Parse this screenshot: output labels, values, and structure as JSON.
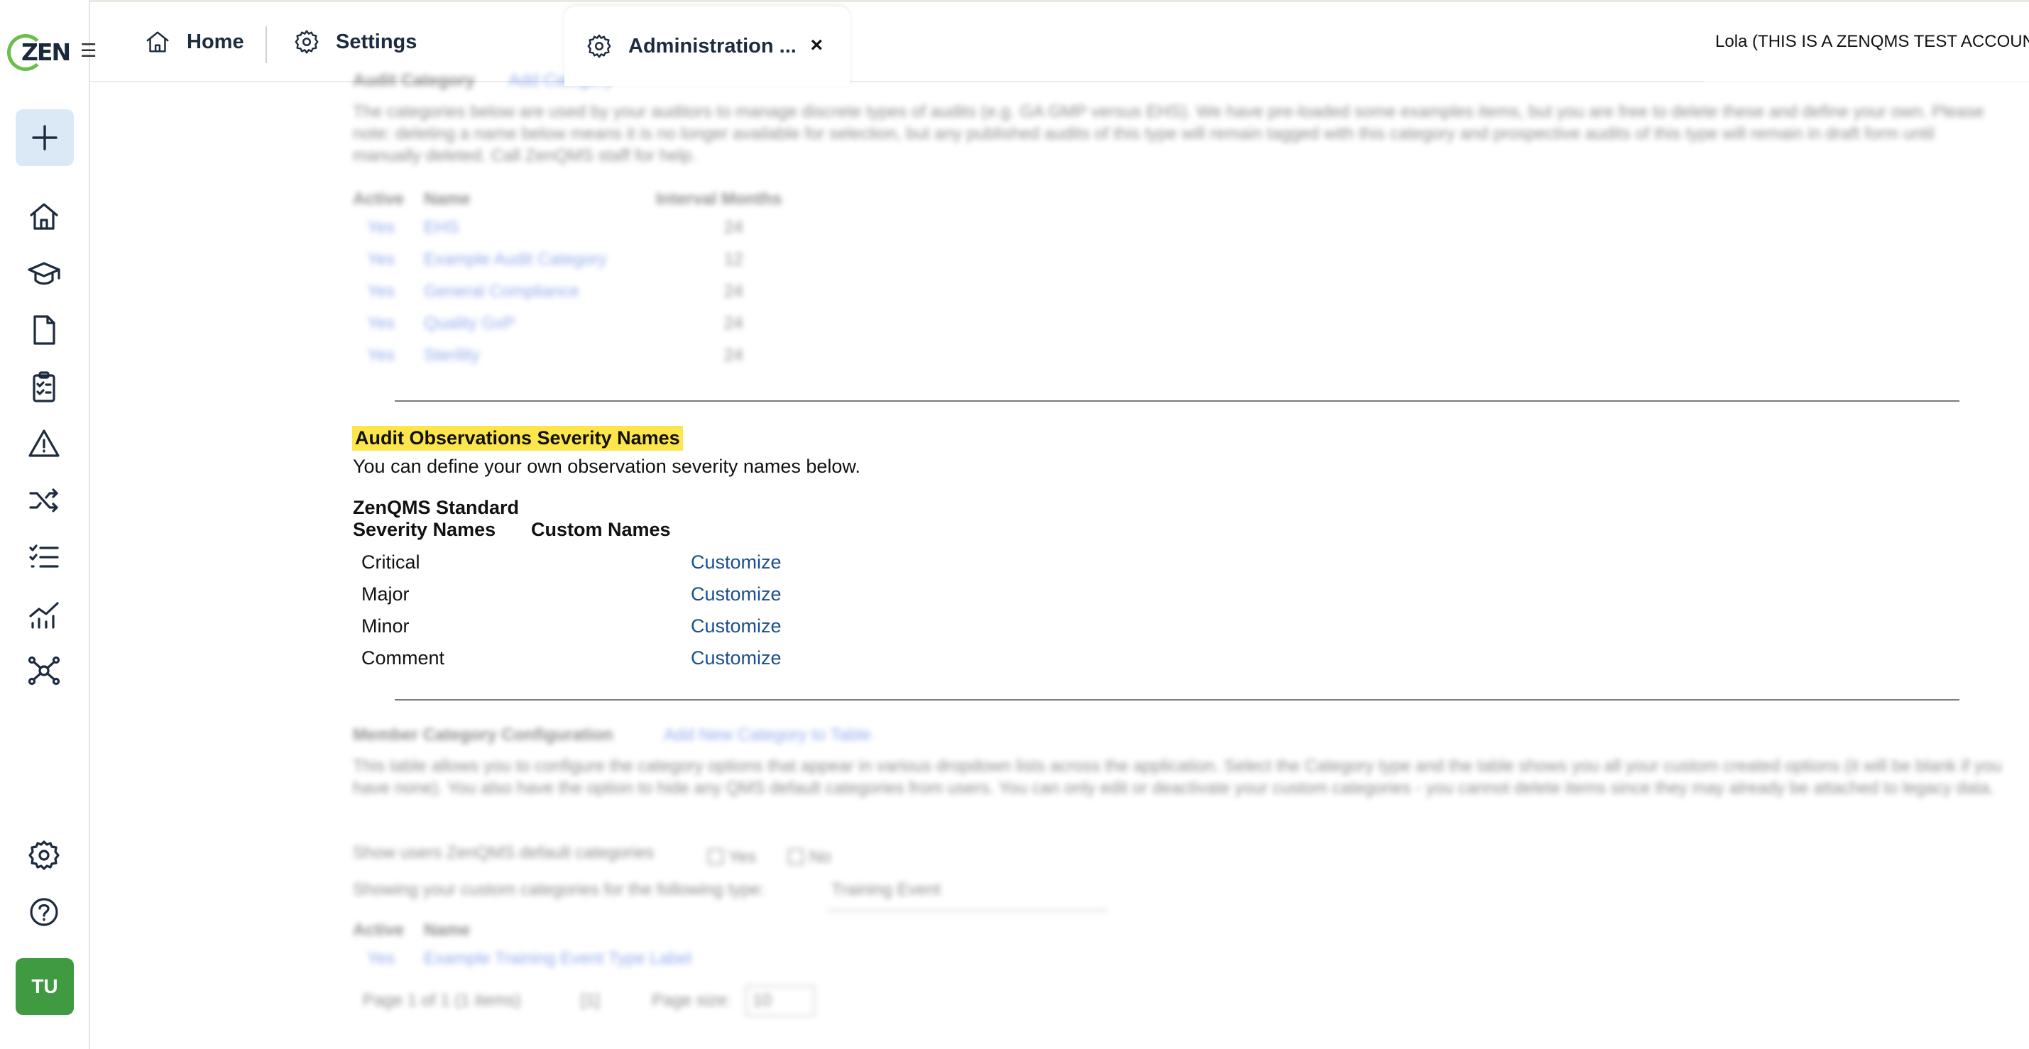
{
  "app": {
    "logo_text": "ZEN",
    "user_name": "Lola (THIS IS A ZENQMS TEST ACCOUNT"
  },
  "tabs": {
    "home_label": "Home",
    "settings_label": "Settings",
    "admin_label": "Administration ...",
    "admin_close": "×"
  },
  "rail": {
    "menu_icon": "☰",
    "avatar_initials": "TU",
    "icons": [
      "plus-icon",
      "home-icon",
      "graduation-cap-icon",
      "document-icon",
      "clipboard-checklist-icon",
      "warning-triangle-icon",
      "shuffle-icon",
      "checklist-icon",
      "analytics-chart-icon",
      "network-hub-icon",
      "gear-icon",
      "help-circle-icon"
    ]
  },
  "audit_category": {
    "heading": "Audit Category",
    "add_link": "Add Category",
    "description": "The categories below are used by your auditors to manage discrete types of audits (e.g. GA GMP versus EHS). We have pre-loaded some examples items, but you are free to delete these and define your own. Please note: deleting a name below means it is no longer available for selection, but any published audits of this type will remain tagged with this category and prospective audits of this type will remain in draft form until manually deleted. Call ZenQMS staff for help.",
    "columns": [
      "Active",
      "Name",
      "Interval Months"
    ],
    "rows": [
      {
        "active": "Yes",
        "name": "EHS",
        "interval": "24"
      },
      {
        "active": "Yes",
        "name": "Example Audit Category",
        "interval": "12"
      },
      {
        "active": "Yes",
        "name": "General Compliance",
        "interval": "24"
      },
      {
        "active": "Yes",
        "name": "Quality GxP",
        "interval": "24"
      },
      {
        "active": "Yes",
        "name": "Sterility",
        "interval": "24"
      }
    ]
  },
  "severity": {
    "title": "Audit Observations Severity Names",
    "description": "You can define your own observation severity names below.",
    "col_standard_line1": "ZenQMS Standard",
    "col_standard_line2": "Severity Names",
    "col_custom": "Custom Names",
    "rows": [
      {
        "name": "Critical",
        "action": "Customize"
      },
      {
        "name": "Major",
        "action": "Customize"
      },
      {
        "name": "Minor",
        "action": "Customize"
      },
      {
        "name": "Comment",
        "action": "Customize"
      }
    ]
  },
  "member_category": {
    "heading": "Member Category Configuration",
    "add_link": "Add New Category to Table",
    "description": "This table allows you to configure the category options that appear in various dropdown lists across the application. Select the Category type and the table shows you all your custom created options (it will be blank if you have none). You also have the option to hide any QMS default categories from users. You can only edit or deactivate your custom categories - you cannot delete items since they may already be attached to legacy data.",
    "show_default_label": "Show users ZenQMS default categories",
    "opt_yes": "Yes",
    "opt_no": "No",
    "showing_label": "Showing your custom categories for the following type:",
    "type_value": "Training Event",
    "columns": [
      "Active",
      "Name"
    ],
    "rows": [
      {
        "active": "Yes",
        "name": "Example Training Event Type Label"
      }
    ],
    "pager_text": "Page 1 of 1 (1 items)",
    "pager_page": "[1]",
    "page_size_label": "Page size:",
    "page_size_value": "10"
  }
}
